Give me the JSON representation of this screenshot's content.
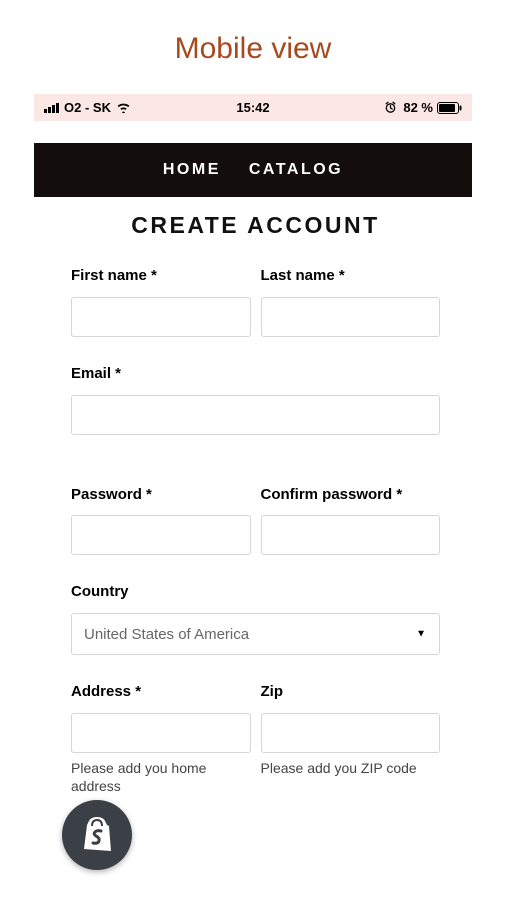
{
  "heading": "Mobile view",
  "statusBar": {
    "carrier": "O2 - SK",
    "time": "15:42",
    "batteryPercent": "82 %"
  },
  "nav": {
    "home": "HOME",
    "catalog": "CATALOG"
  },
  "form": {
    "title": "CREATE ACCOUNT",
    "firstName": {
      "label": "First name *"
    },
    "lastName": {
      "label": "Last name *"
    },
    "email": {
      "label": "Email *"
    },
    "password": {
      "label": "Password *"
    },
    "confirmPassword": {
      "label": "Confirm password *"
    },
    "country": {
      "label": "Country",
      "value": "United States of America"
    },
    "address": {
      "label": "Address *",
      "helper": "Please add you home address"
    },
    "zip": {
      "label": "Zip",
      "helper": "Please add you ZIP code"
    }
  }
}
